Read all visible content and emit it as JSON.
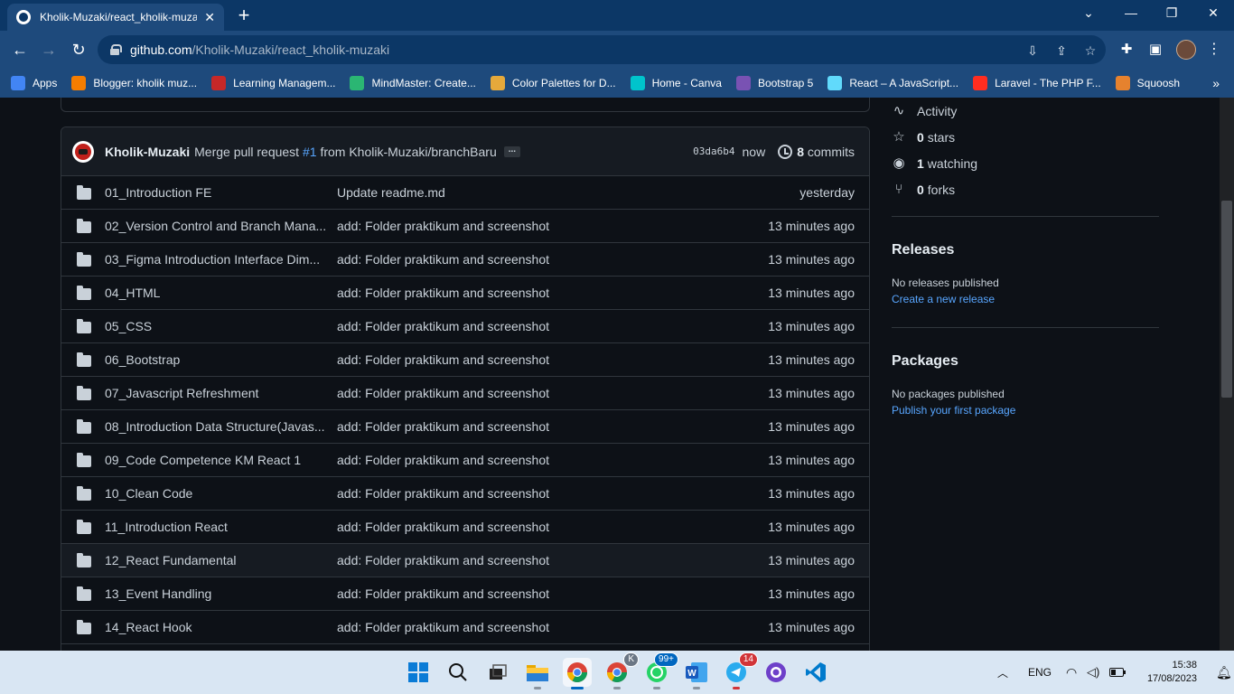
{
  "browser": {
    "tab_title": "Kholik-Muzaki/react_kholik-muzaki",
    "url_host": "github.com",
    "url_path": "/Kholik-Muzaki/react_kholik-muzaki",
    "bookmarks": [
      {
        "label": "Apps",
        "icon": "apps-grid-icon",
        "color": "#4285f4"
      },
      {
        "label": "Blogger: kholik muz...",
        "icon": "blogger-icon",
        "color": "#f57d00"
      },
      {
        "label": "Learning Managem...",
        "icon": "learning-icon",
        "color": "#c62828"
      },
      {
        "label": "MindMaster: Create...",
        "icon": "mindmaster-icon",
        "color": "#2bb673"
      },
      {
        "label": "Color Palettes for D...",
        "icon": "palette-icon",
        "color": "#e5a93b"
      },
      {
        "label": "Home - Canva",
        "icon": "canva-icon",
        "color": "#00c4cc"
      },
      {
        "label": "Bootstrap 5",
        "icon": "bootstrap-icon",
        "color": "#7952b3"
      },
      {
        "label": "React – A JavaScript...",
        "icon": "react-icon",
        "color": "#61dafb"
      },
      {
        "label": "Laravel - The PHP F...",
        "icon": "laravel-icon",
        "color": "#ff2d20"
      },
      {
        "label": "Squoosh",
        "icon": "squoosh-icon",
        "color": "#e6822e"
      }
    ]
  },
  "commit": {
    "author": "Kholik-Muzaki",
    "msg_prefix": "Merge pull request",
    "pr": "#1",
    "msg_suffix": "from Kholik-Muzaki/branchBaru",
    "more": "...",
    "sha": "03da6b4",
    "when": "now",
    "commits_count": "8",
    "commits_label": "commits"
  },
  "files": [
    {
      "name": "01_Introduction FE",
      "msg": "Update readme.md",
      "age": "yesterday"
    },
    {
      "name": "02_Version Control and Branch Mana...",
      "msg": "add: Folder praktikum and screenshot",
      "age": "13 minutes ago"
    },
    {
      "name": "03_Figma Introduction Interface Dim...",
      "msg": "add: Folder praktikum and screenshot",
      "age": "13 minutes ago"
    },
    {
      "name": "04_HTML",
      "msg": "add: Folder praktikum and screenshot",
      "age": "13 minutes ago"
    },
    {
      "name": "05_CSS",
      "msg": "add: Folder praktikum and screenshot",
      "age": "13 minutes ago"
    },
    {
      "name": "06_Bootstrap",
      "msg": "add: Folder praktikum and screenshot",
      "age": "13 minutes ago"
    },
    {
      "name": "07_Javascript Refreshment",
      "msg": "add: Folder praktikum and screenshot",
      "age": "13 minutes ago"
    },
    {
      "name": "08_Introduction Data Structure(Javas...",
      "msg": "add: Folder praktikum and screenshot",
      "age": "13 minutes ago"
    },
    {
      "name": "09_Code Competence KM React 1",
      "msg": "add: Folder praktikum and screenshot",
      "age": "13 minutes ago"
    },
    {
      "name": "10_Clean Code",
      "msg": "add: Folder praktikum and screenshot",
      "age": "13 minutes ago"
    },
    {
      "name": "11_Introduction React",
      "msg": "add: Folder praktikum and screenshot",
      "age": "13 minutes ago"
    },
    {
      "name": "12_React Fundamental",
      "msg": "add: Folder praktikum and screenshot",
      "age": "13 minutes ago"
    },
    {
      "name": "13_Event Handling",
      "msg": "add: Folder praktikum and screenshot",
      "age": "13 minutes ago"
    },
    {
      "name": "14_React Hook",
      "msg": "add: Folder praktikum and screenshot",
      "age": "13 minutes ago"
    }
  ],
  "sidebar": {
    "activity": "Activity",
    "stars_count": "0",
    "stars_label": "stars",
    "watching_count": "1",
    "watching_label": "watching",
    "forks_count": "0",
    "forks_label": "forks",
    "releases_title": "Releases",
    "releases_empty": "No releases published",
    "releases_link": "Create a new release",
    "packages_title": "Packages",
    "packages_empty": "No packages published",
    "packages_link": "Publish your first package"
  },
  "taskbar": {
    "lang": "ENG",
    "time": "15:38",
    "date": "17/08/2023",
    "whatsapp_badge": "99+",
    "telegram_badge": "14",
    "chrome2_badge": "K"
  }
}
